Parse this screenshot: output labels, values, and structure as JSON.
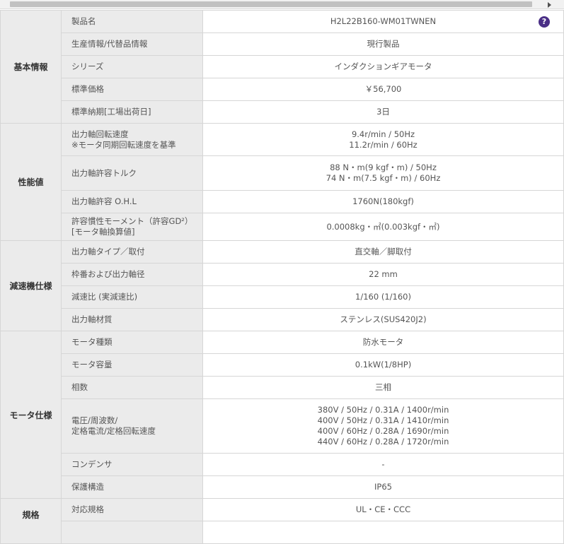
{
  "groups": {
    "basic": "基本情報",
    "perf": "性能値",
    "reducer": "減速機仕様",
    "motor": "モータ仕様",
    "standard": "規格"
  },
  "help_icon": {
    "name": "question-circle-icon",
    "glyph": "?",
    "color": "#4a2f86"
  },
  "rows": {
    "product_name": {
      "label": "製品名",
      "value": "H2L22B160-WM01TWNEN"
    },
    "production": {
      "label": "生産情報/代替品情報",
      "value": "現行製品"
    },
    "series": {
      "label": "シリーズ",
      "value": "インダクションギアモータ"
    },
    "price": {
      "label": "標準価格",
      "value": "￥56,700"
    },
    "delivery": {
      "label": "標準納期[工場出荷日]",
      "value": "3日"
    },
    "speed": {
      "label": [
        "出力軸回転速度",
        "※モータ同期回転速度を基準"
      ],
      "value": [
        "9.4r/min / 50Hz",
        "11.2r/min / 60Hz"
      ]
    },
    "torque": {
      "label": "出力軸許容トルク",
      "value": [
        "88 N・m(9 kgf・m) / 50Hz",
        "74 N・m(7.5 kgf・m) / 60Hz"
      ]
    },
    "ohl": {
      "label": "出力軸許容 O.H.L",
      "value": "1760N(180kgf)"
    },
    "inertia": {
      "label": [
        "許容慣性モーメント（許容GD²）",
        "[モータ軸換算値]"
      ],
      "value": "0.0008kg・㎡(0.003kgf・㎡)"
    },
    "shaft_type": {
      "label": "出力軸タイプ／取付",
      "value": "直交軸／脚取付"
    },
    "frame": {
      "label": "枠番および出力軸径",
      "value": "22 mm"
    },
    "ratio": {
      "label": "減速比 (実減速比)",
      "value": "1/160 (1/160)"
    },
    "material": {
      "label": "出力軸材質",
      "value": "ステンレス(SUS420J2)"
    },
    "motor_type": {
      "label": "モータ種類",
      "value": "防水モータ"
    },
    "capacity": {
      "label": "モータ容量",
      "value": "0.1kW(1/8HP)"
    },
    "phase": {
      "label": "相数",
      "value": "三相"
    },
    "voltage": {
      "label": [
        "電圧/周波数/",
        "定格電流/定格回転速度"
      ],
      "value": [
        "380V / 50Hz / 0.31A / 1400r/min",
        "400V / 50Hz / 0.31A / 1410r/min",
        "400V / 60Hz / 0.28A / 1690r/min",
        "440V / 60Hz / 0.28A / 1720r/min"
      ]
    },
    "condenser": {
      "label": "コンデンサ",
      "value": "-"
    },
    "protection": {
      "label": "保護構造",
      "value": "IP65"
    },
    "standards": {
      "label": "対応規格",
      "value": "UL・CE・CCC"
    }
  }
}
